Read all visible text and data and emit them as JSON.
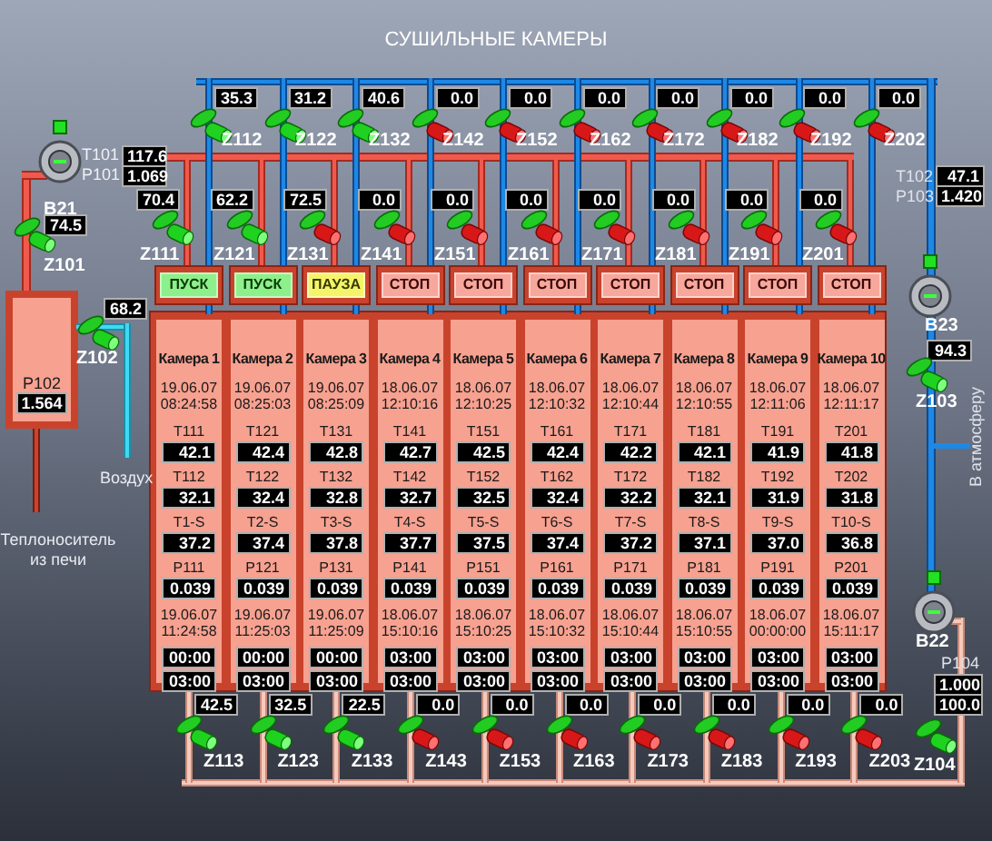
{
  "title": "СУШИЛЬНЫЕ КАМЕРЫ",
  "chambers": [
    {
      "name": "Камера 1",
      "kind": "run",
      "button": "ПУСК",
      "start_date": "19.06.07",
      "start_time": "08:24:58",
      "t1_label": "T111",
      "t1": "42.1",
      "t2_label": "T112",
      "t2": "32.1",
      "s_label": "T1-S",
      "s": "37.2",
      "p_label": "P111",
      "p": "0.039",
      "end_date": "19.06.07",
      "end_time": "11:24:58",
      "timer_1": "00:00",
      "timer_2": "03:00",
      "top_valve": {
        "tag": "Z112",
        "value": "35.3",
        "open": true
      },
      "mid_valve": {
        "tag": "Z111",
        "value": "70.4",
        "open": true
      },
      "bottom_valve": {
        "tag": "Z113",
        "value": "42.5",
        "open": true
      }
    },
    {
      "name": "Камера 2",
      "kind": "run",
      "button": "ПУСК",
      "start_date": "19.06.07",
      "start_time": "08:25:03",
      "t1_label": "T121",
      "t1": "42.4",
      "t2_label": "T122",
      "t2": "32.4",
      "s_label": "T2-S",
      "s": "37.4",
      "p_label": "P121",
      "p": "0.039",
      "end_date": "19.06.07",
      "end_time": "11:25:03",
      "timer_1": "00:00",
      "timer_2": "03:00",
      "top_valve": {
        "tag": "Z122",
        "value": "31.2",
        "open": true
      },
      "mid_valve": {
        "tag": "Z121",
        "value": "62.2",
        "open": true
      },
      "bottom_valve": {
        "tag": "Z123",
        "value": "32.5",
        "open": true
      }
    },
    {
      "name": "Камера 3",
      "kind": "pause",
      "button": "ПАУЗА",
      "start_date": "19.06.07",
      "start_time": "08:25:09",
      "t1_label": "T131",
      "t1": "42.8",
      "t2_label": "T132",
      "t2": "32.8",
      "s_label": "T3-S",
      "s": "37.8",
      "p_label": "P131",
      "p": "0.039",
      "end_date": "19.06.07",
      "end_time": "11:25:09",
      "timer_1": "00:00",
      "timer_2": "03:00",
      "top_valve": {
        "tag": "Z132",
        "value": "40.6",
        "open": true
      },
      "mid_valve": {
        "tag": "Z131",
        "value": "72.5",
        "open": false
      },
      "bottom_valve": {
        "tag": "Z133",
        "value": "22.5",
        "open": true
      }
    },
    {
      "name": "Камера 4",
      "kind": "stop",
      "button": "СТОП",
      "start_date": "18.06.07",
      "start_time": "12:10:16",
      "t1_label": "T141",
      "t1": "42.7",
      "t2_label": "T142",
      "t2": "32.7",
      "s_label": "T4-S",
      "s": "37.7",
      "p_label": "P141",
      "p": "0.039",
      "end_date": "18.06.07",
      "end_time": "15:10:16",
      "timer_1": "03:00",
      "timer_2": "03:00",
      "top_valve": {
        "tag": "Z142",
        "value": "0.0",
        "open": false
      },
      "mid_valve": {
        "tag": "Z141",
        "value": "0.0",
        "open": false
      },
      "bottom_valve": {
        "tag": "Z143",
        "value": "0.0",
        "open": false
      }
    },
    {
      "name": "Камера 5",
      "kind": "stop",
      "button": "СТОП",
      "start_date": "18.06.07",
      "start_time": "12:10:25",
      "t1_label": "T151",
      "t1": "42.5",
      "t2_label": "T152",
      "t2": "32.5",
      "s_label": "T5-S",
      "s": "37.5",
      "p_label": "P151",
      "p": "0.039",
      "end_date": "18.06.07",
      "end_time": "15:10:25",
      "timer_1": "03:00",
      "timer_2": "03:00",
      "top_valve": {
        "tag": "Z152",
        "value": "0.0",
        "open": false
      },
      "mid_valve": {
        "tag": "Z151",
        "value": "0.0",
        "open": false
      },
      "bottom_valve": {
        "tag": "Z153",
        "value": "0.0",
        "open": false
      }
    },
    {
      "name": "Камера 6",
      "kind": "stop",
      "button": "СТОП",
      "start_date": "18.06.07",
      "start_time": "12:10:32",
      "t1_label": "T161",
      "t1": "42.4",
      "t2_label": "T162",
      "t2": "32.4",
      "s_label": "T6-S",
      "s": "37.4",
      "p_label": "P161",
      "p": "0.039",
      "end_date": "18.06.07",
      "end_time": "15:10:32",
      "timer_1": "03:00",
      "timer_2": "03:00",
      "top_valve": {
        "tag": "Z162",
        "value": "0.0",
        "open": false
      },
      "mid_valve": {
        "tag": "Z161",
        "value": "0.0",
        "open": false
      },
      "bottom_valve": {
        "tag": "Z163",
        "value": "0.0",
        "open": false
      }
    },
    {
      "name": "Камера 7",
      "kind": "stop",
      "button": "СТОП",
      "start_date": "18.06.07",
      "start_time": "12:10:44",
      "t1_label": "T171",
      "t1": "42.2",
      "t2_label": "T172",
      "t2": "32.2",
      "s_label": "T7-S",
      "s": "37.2",
      "p_label": "P171",
      "p": "0.039",
      "end_date": "18.06.07",
      "end_time": "15:10:44",
      "timer_1": "03:00",
      "timer_2": "03:00",
      "top_valve": {
        "tag": "Z172",
        "value": "0.0",
        "open": false
      },
      "mid_valve": {
        "tag": "Z171",
        "value": "0.0",
        "open": false
      },
      "bottom_valve": {
        "tag": "Z173",
        "value": "0.0",
        "open": false
      }
    },
    {
      "name": "Камера 8",
      "kind": "stop",
      "button": "СТОП",
      "start_date": "18.06.07",
      "start_time": "12:10:55",
      "t1_label": "T181",
      "t1": "42.1",
      "t2_label": "T182",
      "t2": "32.1",
      "s_label": "T8-S",
      "s": "37.1",
      "p_label": "P181",
      "p": "0.039",
      "end_date": "18.06.07",
      "end_time": "15:10:55",
      "timer_1": "03:00",
      "timer_2": "03:00",
      "top_valve": {
        "tag": "Z182",
        "value": "0.0",
        "open": false
      },
      "mid_valve": {
        "tag": "Z181",
        "value": "0.0",
        "open": false
      },
      "bottom_valve": {
        "tag": "Z183",
        "value": "0.0",
        "open": false
      }
    },
    {
      "name": "Камера 9",
      "kind": "stop",
      "button": "СТОП",
      "start_date": "18.06.07",
      "start_time": "12:11:06",
      "t1_label": "T191",
      "t1": "41.9",
      "t2_label": "T192",
      "t2": "31.9",
      "s_label": "T9-S",
      "s": "37.0",
      "p_label": "P191",
      "p": "0.039",
      "end_date": "18.06.07",
      "end_time": "00:00:00",
      "timer_1": "03:00",
      "timer_2": "03:00",
      "top_valve": {
        "tag": "Z192",
        "value": "0.0",
        "open": false
      },
      "mid_valve": {
        "tag": "Z191",
        "value": "0.0",
        "open": false
      },
      "bottom_valve": {
        "tag": "Z193",
        "value": "0.0",
        "open": false
      }
    },
    {
      "name": "Камера 10",
      "kind": "stop",
      "button": "СТОП",
      "start_date": "18.06.07",
      "start_time": "12:11:17",
      "t1_label": "T201",
      "t1": "41.8",
      "t2_label": "T202",
      "t2": "31.8",
      "s_label": "T10-S",
      "s": "36.8",
      "p_label": "P201",
      "p": "0.039",
      "end_date": "18.06.07",
      "end_time": "15:11:17",
      "timer_1": "03:00",
      "timer_2": "03:00",
      "top_valve": {
        "tag": "Z202",
        "value": "0.0",
        "open": false
      },
      "mid_valve": {
        "tag": "Z201",
        "value": "0.0",
        "open": false
      },
      "bottom_valve": {
        "tag": "Z203",
        "value": "0.0",
        "open": false
      }
    }
  ],
  "heat_supply": {
    "fan": {
      "tag": "B21",
      "running": true
    },
    "t_label": "T101",
    "t_value": "117.6",
    "p_label": "P101",
    "p_value": "1.069",
    "valve": {
      "tag": "Z101",
      "value": "74.5",
      "open": true
    },
    "tank": {
      "tag": "P102",
      "value": "1.564"
    },
    "label": "Теплоноситель из печи"
  },
  "air_inlet": {
    "valve": {
      "tag": "Z102",
      "value": "68.2",
      "open": true
    },
    "label": "Воздух"
  },
  "exhaust": {
    "t_label": "T102",
    "t_value": "47.1",
    "p_label": "P103",
    "p_value": "1.420",
    "fan": {
      "tag": "B23",
      "running": true
    },
    "valve": {
      "tag": "Z103",
      "value": "94.3",
      "open": true
    },
    "label": "В атмосферу"
  },
  "return": {
    "fan": {
      "tag": "B22",
      "running": true
    },
    "p_label": "P104",
    "p_value": "1.000",
    "valve": {
      "tag": "Z104",
      "value": "100.0",
      "open": true
    }
  }
}
